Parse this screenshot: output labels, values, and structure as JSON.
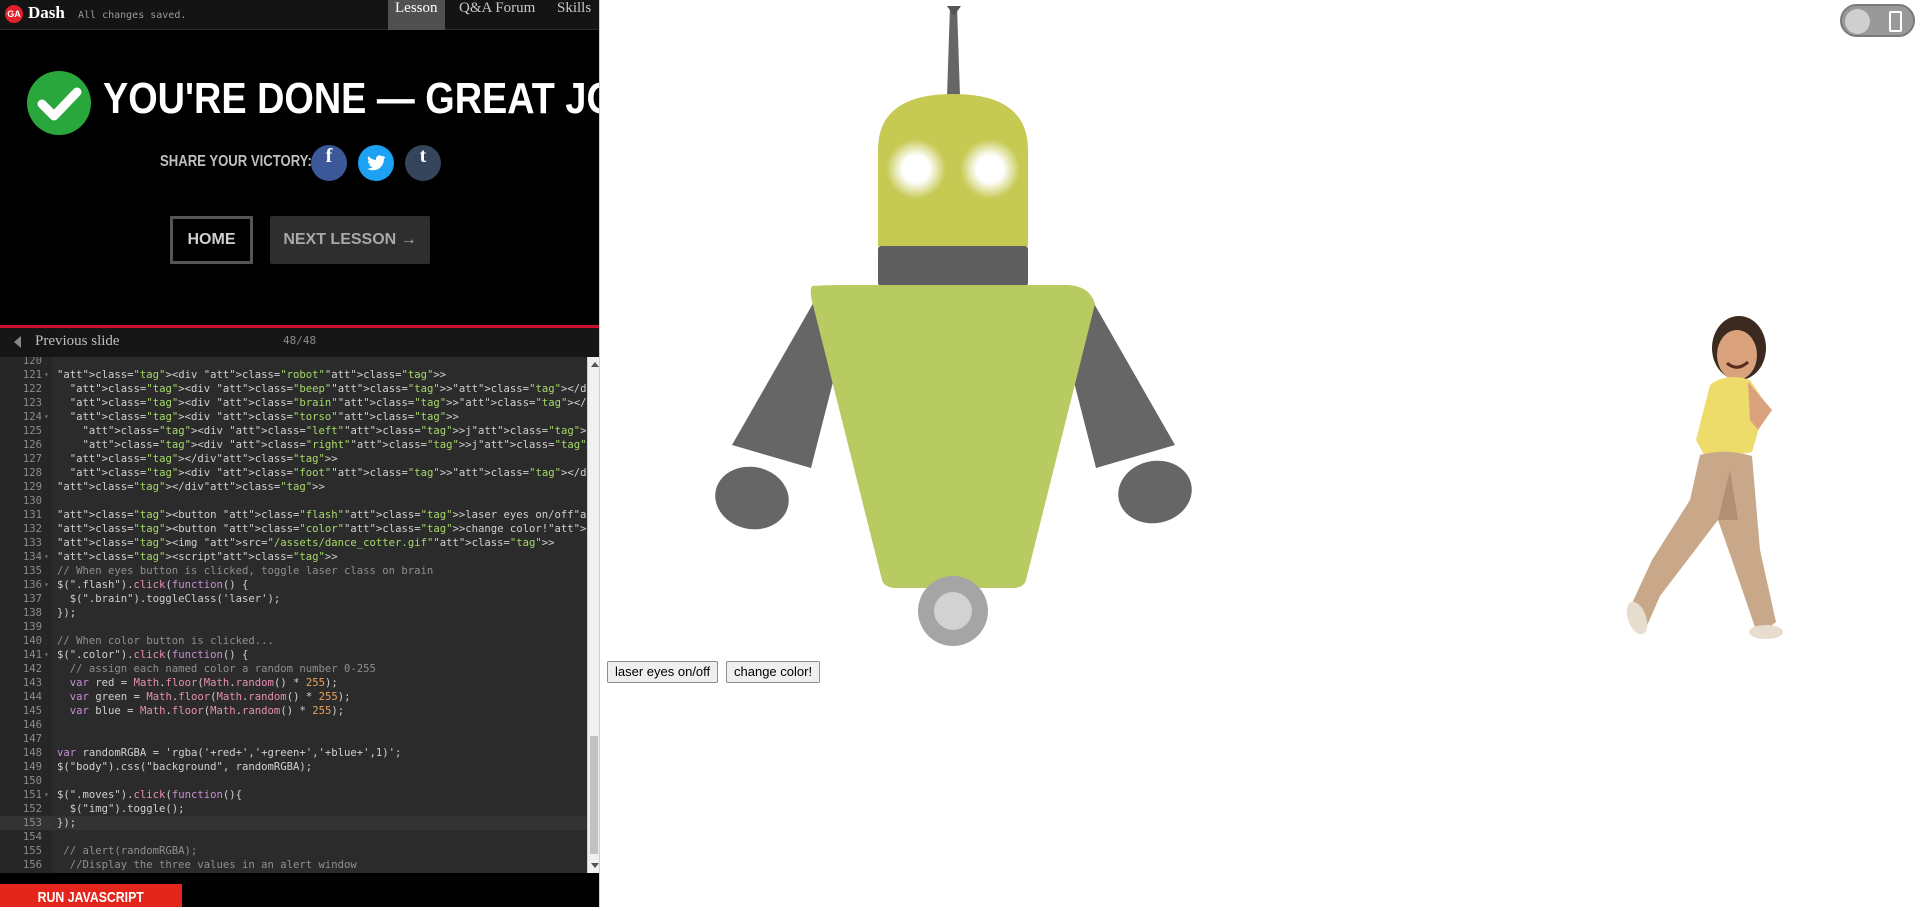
{
  "topbar": {
    "logo_text": "GA",
    "brand": "Dash",
    "status": "All changes saved.",
    "tabs": [
      {
        "label": "Lesson",
        "active": true
      },
      {
        "label": "Q&A Forum",
        "active": false
      },
      {
        "label": "Skills",
        "active": false
      }
    ]
  },
  "completion": {
    "heading": "YOU'RE DONE — GREAT JOB!",
    "share_label": "SHARE YOUR VICTORY:",
    "social": [
      {
        "icon": "facebook-icon",
        "glyph": "f",
        "color": "#3b5998"
      },
      {
        "icon": "twitter-icon",
        "glyph": "t",
        "color": "#1da1f2"
      },
      {
        "icon": "tumblr-icon",
        "glyph": "t",
        "color": "#35465c"
      }
    ],
    "home_label": "HOME",
    "next_label": "NEXT LESSON →",
    "check_color": "#29a63c"
  },
  "slide_nav": {
    "previous_label": "Previous slide",
    "counter": "48/48"
  },
  "editor": {
    "lines": [
      {
        "n": "120",
        "text": ""
      },
      {
        "n": "121",
        "text": "<div class=\"robot\">",
        "fold": true
      },
      {
        "n": "122",
        "text": "  <div class=\"beep\"></div>"
      },
      {
        "n": "123",
        "text": "  <div class=\"brain\"></div>"
      },
      {
        "n": "124",
        "text": "  <div class=\"torso\">",
        "fold": true
      },
      {
        "n": "125",
        "text": "    <div class=\"left\">j</div>"
      },
      {
        "n": "126",
        "text": "    <div class=\"right\">j</div>"
      },
      {
        "n": "127",
        "text": "  </div>"
      },
      {
        "n": "128",
        "text": "  <div class=\"foot\"></div>"
      },
      {
        "n": "129",
        "text": "</div>"
      },
      {
        "n": "130",
        "text": ""
      },
      {
        "n": "131",
        "text": "<button class=\"flash\">laser eyes on/off</button>"
      },
      {
        "n": "132",
        "text": "<button class=\"color\">change color!</button>"
      },
      {
        "n": "133",
        "text": "<img src=\"/assets/dance_cotter.gif\">"
      },
      {
        "n": "134",
        "text": "<script>",
        "fold": true
      },
      {
        "n": "135",
        "text": "// When eyes button is clicked, toggle laser class on brain"
      },
      {
        "n": "136",
        "text": "$(\".flash\").click(function() {",
        "fold": true
      },
      {
        "n": "137",
        "text": "  $(\".brain\").toggleClass('laser');"
      },
      {
        "n": "138",
        "text": "});"
      },
      {
        "n": "139",
        "text": ""
      },
      {
        "n": "140",
        "text": "// When color button is clicked..."
      },
      {
        "n": "141",
        "text": "$(\".color\").click(function() {",
        "fold": true
      },
      {
        "n": "142",
        "text": "  // assign each named color a random number 0-255"
      },
      {
        "n": "143",
        "text": "  var red = Math.floor(Math.random() * 255);"
      },
      {
        "n": "144",
        "text": "  var green = Math.floor(Math.random() * 255);"
      },
      {
        "n": "145",
        "text": "  var blue = Math.floor(Math.random() * 255);"
      },
      {
        "n": "146",
        "text": ""
      },
      {
        "n": "147",
        "text": ""
      },
      {
        "n": "148",
        "text": "var randomRGBA = 'rgba('+red+','+green+','+blue+',1)';"
      },
      {
        "n": "149",
        "text": "$(\"body\").css(\"background\", randomRGBA);"
      },
      {
        "n": "150",
        "text": ""
      },
      {
        "n": "151",
        "text": "$(\".moves\").click(function(){",
        "fold": true
      },
      {
        "n": "152",
        "text": "  $(\"img\").toggle();"
      },
      {
        "n": "153",
        "text": "});",
        "current": true
      },
      {
        "n": "154",
        "text": ""
      },
      {
        "n": "155",
        "text": " // alert(randomRGBA);"
      },
      {
        "n": "156",
        "text": "  //Display the three values in an alert window"
      }
    ]
  },
  "run_label": "RUN JAVASCRIPT",
  "preview": {
    "buttons": [
      "laser eyes on/off",
      "change color!"
    ],
    "robot_colors": {
      "head": "#c6c952",
      "torso": "#b8cb63",
      "gray": "#666666",
      "neck": "#5f5f5f",
      "eyes": "#ffffff",
      "foot": "#a5a5a5"
    }
  }
}
